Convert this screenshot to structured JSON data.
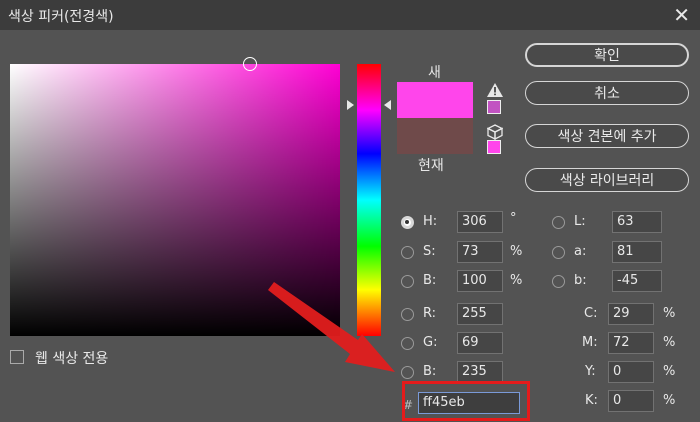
{
  "window": {
    "title": "색상 피커(전경색)",
    "close_icon": "close-icon"
  },
  "preview": {
    "new_label": "새",
    "current_label": "현재",
    "new_color": "#ff45eb",
    "current_color": "#6f4a4a"
  },
  "buttons": {
    "ok": "확인",
    "cancel": "취소",
    "add_swatches": "색상 견본에 추가",
    "color_libraries": "색상 라이브러리"
  },
  "hsb": {
    "h": {
      "label": "H:",
      "value": "306",
      "unit": "°"
    },
    "s": {
      "label": "S:",
      "value": "73",
      "unit": "%"
    },
    "b": {
      "label": "B:",
      "value": "100",
      "unit": "%"
    }
  },
  "rgb": {
    "r": {
      "label": "R:",
      "value": "255"
    },
    "g": {
      "label": "G:",
      "value": "69"
    },
    "b": {
      "label": "B:",
      "value": "235"
    }
  },
  "lab": {
    "l": {
      "label": "L:",
      "value": "63"
    },
    "a": {
      "label": "a:",
      "value": "81"
    },
    "b": {
      "label": "b:",
      "value": "-45"
    }
  },
  "cmyk": {
    "c": {
      "label": "C:",
      "value": "29",
      "unit": "%"
    },
    "m": {
      "label": "M:",
      "value": "72",
      "unit": "%"
    },
    "y": {
      "label": "Y:",
      "value": "0",
      "unit": "%"
    },
    "k": {
      "label": "K:",
      "value": "0",
      "unit": "%"
    }
  },
  "hex": {
    "symbol": "#",
    "value": "ff45eb"
  },
  "web_only": {
    "label": "웹 색상 전용",
    "checked": false
  },
  "colors": {
    "highlight": "#e41b1b",
    "arrow": "#e21e1e",
    "hue_base": "#ff00d4"
  }
}
